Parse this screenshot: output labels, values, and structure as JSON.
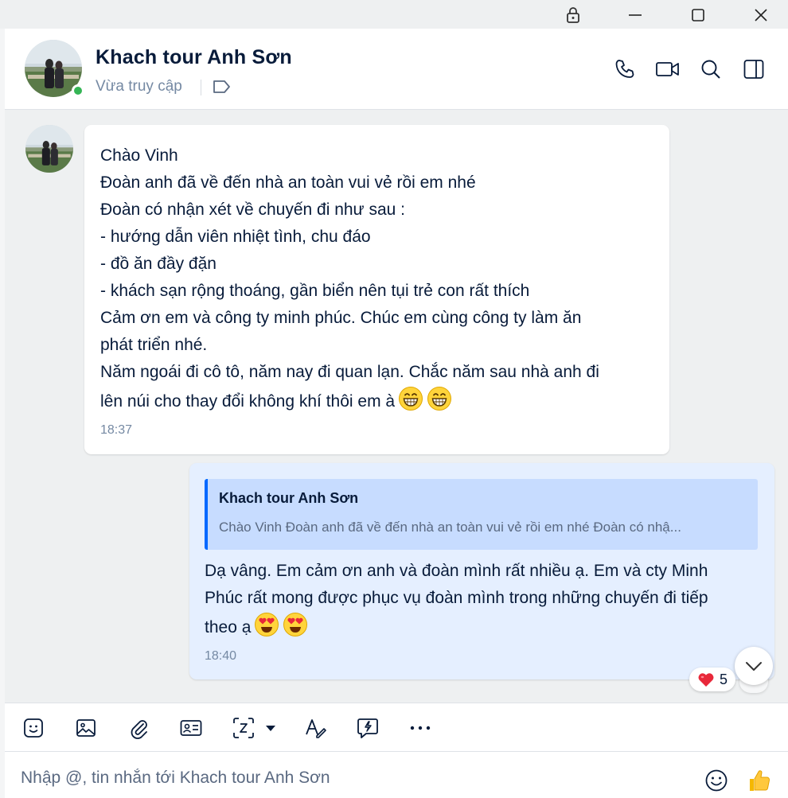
{
  "window": {
    "controls": [
      "lock-icon",
      "minimize-icon",
      "maximize-icon",
      "close-icon"
    ]
  },
  "header": {
    "contact_name": "Khach tour Anh Sơn",
    "status": "Vừa truy cập",
    "online": true,
    "actions": [
      "phone-icon",
      "video-icon",
      "search-icon",
      "sidebar-toggle-icon"
    ]
  },
  "messages": {
    "incoming": {
      "lines": [
        "Chào Vinh",
        "Đoàn anh đã về đến nhà an toàn vui vẻ rồi em nhé",
        "Đoàn có nhận xét về chuyến đi như sau :",
        "- hướng dẫn viên nhiệt tình, chu đáo",
        "- đồ ăn đầy đặn",
        "- khách sạn rộng thoáng, gần biển nên tụi trẻ con rất thích",
        "Cảm ơn em và công ty minh phúc. Chúc em cùng công ty làm ăn",
        "phát triển nhé.",
        "Năm ngoái đi cô tô, năm nay đi quan lạn. Chắc năm sau nhà anh đi",
        "lên núi cho thay đổi không khí thôi em à"
      ],
      "emojis": [
        "grinning-emoji",
        "grinning-emoji"
      ],
      "time": "18:37"
    },
    "outgoing": {
      "quote": {
        "name": "Khach tour Anh Sơn",
        "text": "Chào Vinh Đoàn anh đã về đến nhà an toàn vui vẻ rồi em nhé Đoàn có nhậ..."
      },
      "lines": [
        "Dạ vâng. Em cảm ơn anh và đoàn mình rất nhiều ạ. Em và cty Minh",
        "Phúc rất mong được phục vụ đoàn mình trong những chuyến đi tiếp",
        "theo ạ"
      ],
      "emojis": [
        "heart-eyes-emoji",
        "heart-eyes-emoji"
      ],
      "time": "18:40",
      "reaction": {
        "icon": "heart-emoji",
        "count": "5"
      }
    }
  },
  "toolbar": {
    "tools": [
      "sticker-icon",
      "image-icon",
      "attachment-icon",
      "contact-card-icon",
      "screenshot-icon",
      "dropdown-caret-icon",
      "text-format-icon",
      "quick-message-icon",
      "more-icon"
    ]
  },
  "composer": {
    "placeholder": "Nhập @, tin nhắn tới Khach tour Anh Sơn",
    "value": ""
  },
  "colors": {
    "accent": "#0068ff",
    "online": "#35b555",
    "outgoing_bubble": "#e5efff",
    "quote_bg": "#c7dcff"
  }
}
